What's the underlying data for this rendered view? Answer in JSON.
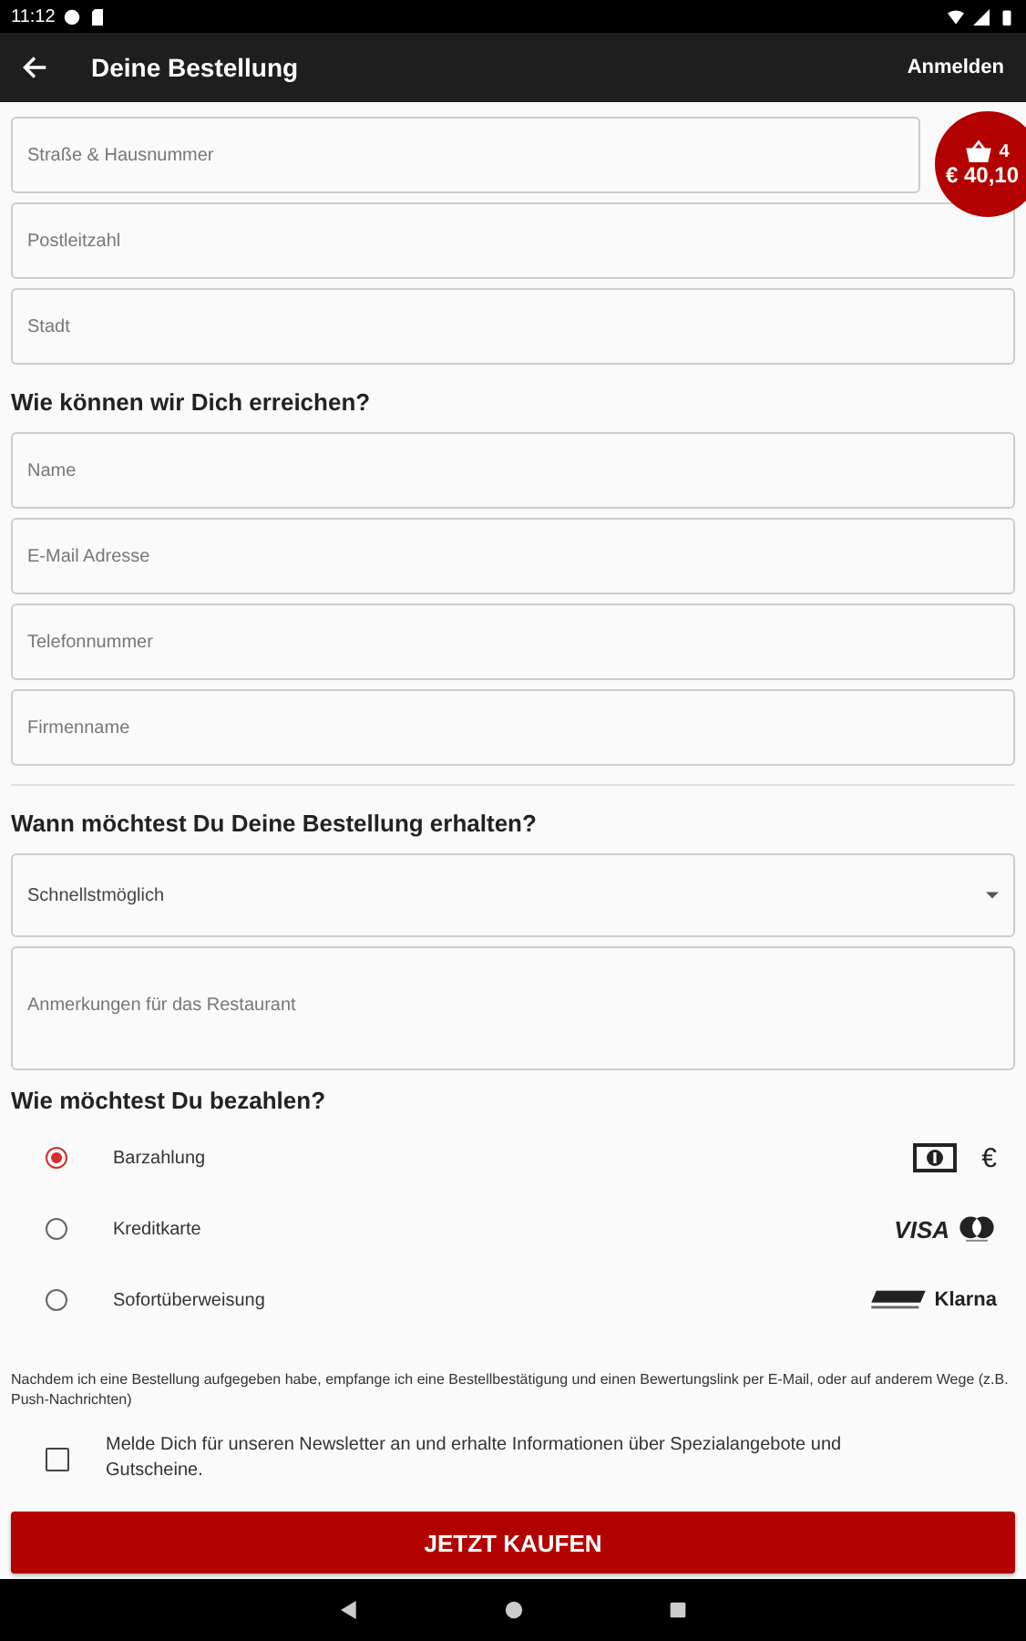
{
  "status_bar": {
    "time": "11:12"
  },
  "app_bar": {
    "title": "Deine Bestellung",
    "action": "Anmelden"
  },
  "cart_badge": {
    "count": "4",
    "total": "€ 40,10"
  },
  "address_fields": [
    {
      "placeholder": "Straße & Hausnummer"
    },
    {
      "placeholder": "Postleitzahl"
    },
    {
      "placeholder": "Stadt"
    }
  ],
  "contact_heading": "Wie können wir Dich erreichen?",
  "contact_fields": [
    {
      "placeholder": "Name"
    },
    {
      "placeholder": "E-Mail Adresse"
    },
    {
      "placeholder": "Telefonnummer"
    },
    {
      "placeholder": "Firmenname"
    }
  ],
  "delivery_heading": "Wann möchtest Du Deine Bestellung erhalten?",
  "delivery_time": {
    "value": "Schnellstmöglich"
  },
  "notes": {
    "placeholder": "Anmerkungen für das Restaurant"
  },
  "payment_heading": "Wie möchtest Du bezahlen?",
  "payment_options": [
    {
      "label": "Barzahlung",
      "selected": true,
      "kind": "cash",
      "mark": "€"
    },
    {
      "label": "Kreditkarte",
      "selected": false,
      "kind": "card",
      "mark": "VISA"
    },
    {
      "label": "Sofortüberweisung",
      "selected": false,
      "kind": "transfer",
      "mark": "Klarna"
    }
  ],
  "disclaimer": "Nachdem ich eine Bestellung aufgegeben habe, empfange ich eine Bestellbestätigung und einen Bewertungslink per E-Mail, oder auf anderem Wege (z.B. Push-Nachrichten)",
  "newsletter": {
    "label": "Melde Dich für unseren Newsletter an und erhalte Informationen über Spezialangebote und Gutscheine.",
    "checked": false
  },
  "buy_button": "JETZT KAUFEN"
}
